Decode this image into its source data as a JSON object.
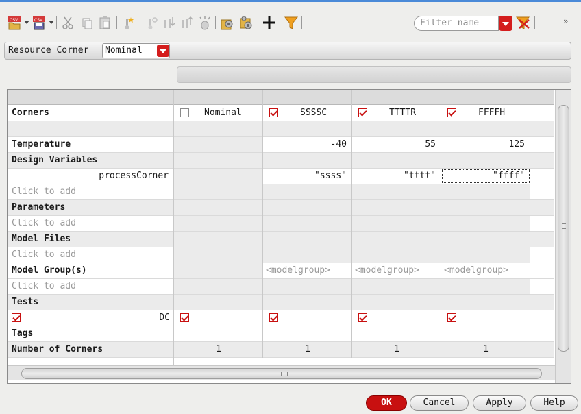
{
  "toolbar": {
    "icons": [
      "load-csv-icon",
      "save-csv-icon",
      "cut-icon",
      "copy-icon",
      "paste-icon",
      "add-corner-icon",
      "add-variable-icon",
      "import-icon",
      "export-icon",
      "sweep-icon",
      "settings-icon",
      "settings-2-icon",
      "add-icon",
      "filter-icon",
      "clear-filter-icon"
    ],
    "filter_placeholder": "Filter name",
    "more": "»",
    "accent": "#d41d1d"
  },
  "resource": {
    "label": "Resource Corner",
    "value": "Nominal"
  },
  "table": {
    "header_label": "Corners",
    "columns": [
      {
        "name": "Nominal",
        "checked": false
      },
      {
        "name": "SSSSC",
        "checked": true
      },
      {
        "name": "TTTTR",
        "checked": true
      },
      {
        "name": "FFFFH",
        "checked": true
      }
    ],
    "rows": {
      "temperature": {
        "label": "Temperature",
        "values": [
          "",
          "-40",
          "55",
          "125"
        ]
      },
      "design_variables": {
        "label": "Design Variables"
      },
      "process_corner": {
        "label": "processCorner",
        "values": [
          "",
          "\"ssss\"",
          "\"tttt\"",
          "\"ffff\""
        ]
      },
      "click_add": "Click to add",
      "parameters": {
        "label": "Parameters"
      },
      "model_files": {
        "label": "Model Files"
      },
      "model_groups": {
        "label": "Model Group(s)",
        "placeholder": "<modelgroup>"
      },
      "tests": {
        "label": "Tests"
      },
      "dc": {
        "label": "DC",
        "checked": [
          true,
          true,
          true,
          true
        ]
      },
      "tags": {
        "label": "Tags"
      },
      "count": {
        "label": "Number of Corners",
        "values": [
          "1",
          "1",
          "1",
          "1"
        ]
      }
    }
  },
  "buttons": {
    "ok": "OK",
    "cancel": "Cancel",
    "apply": "Apply",
    "help": "Help"
  }
}
